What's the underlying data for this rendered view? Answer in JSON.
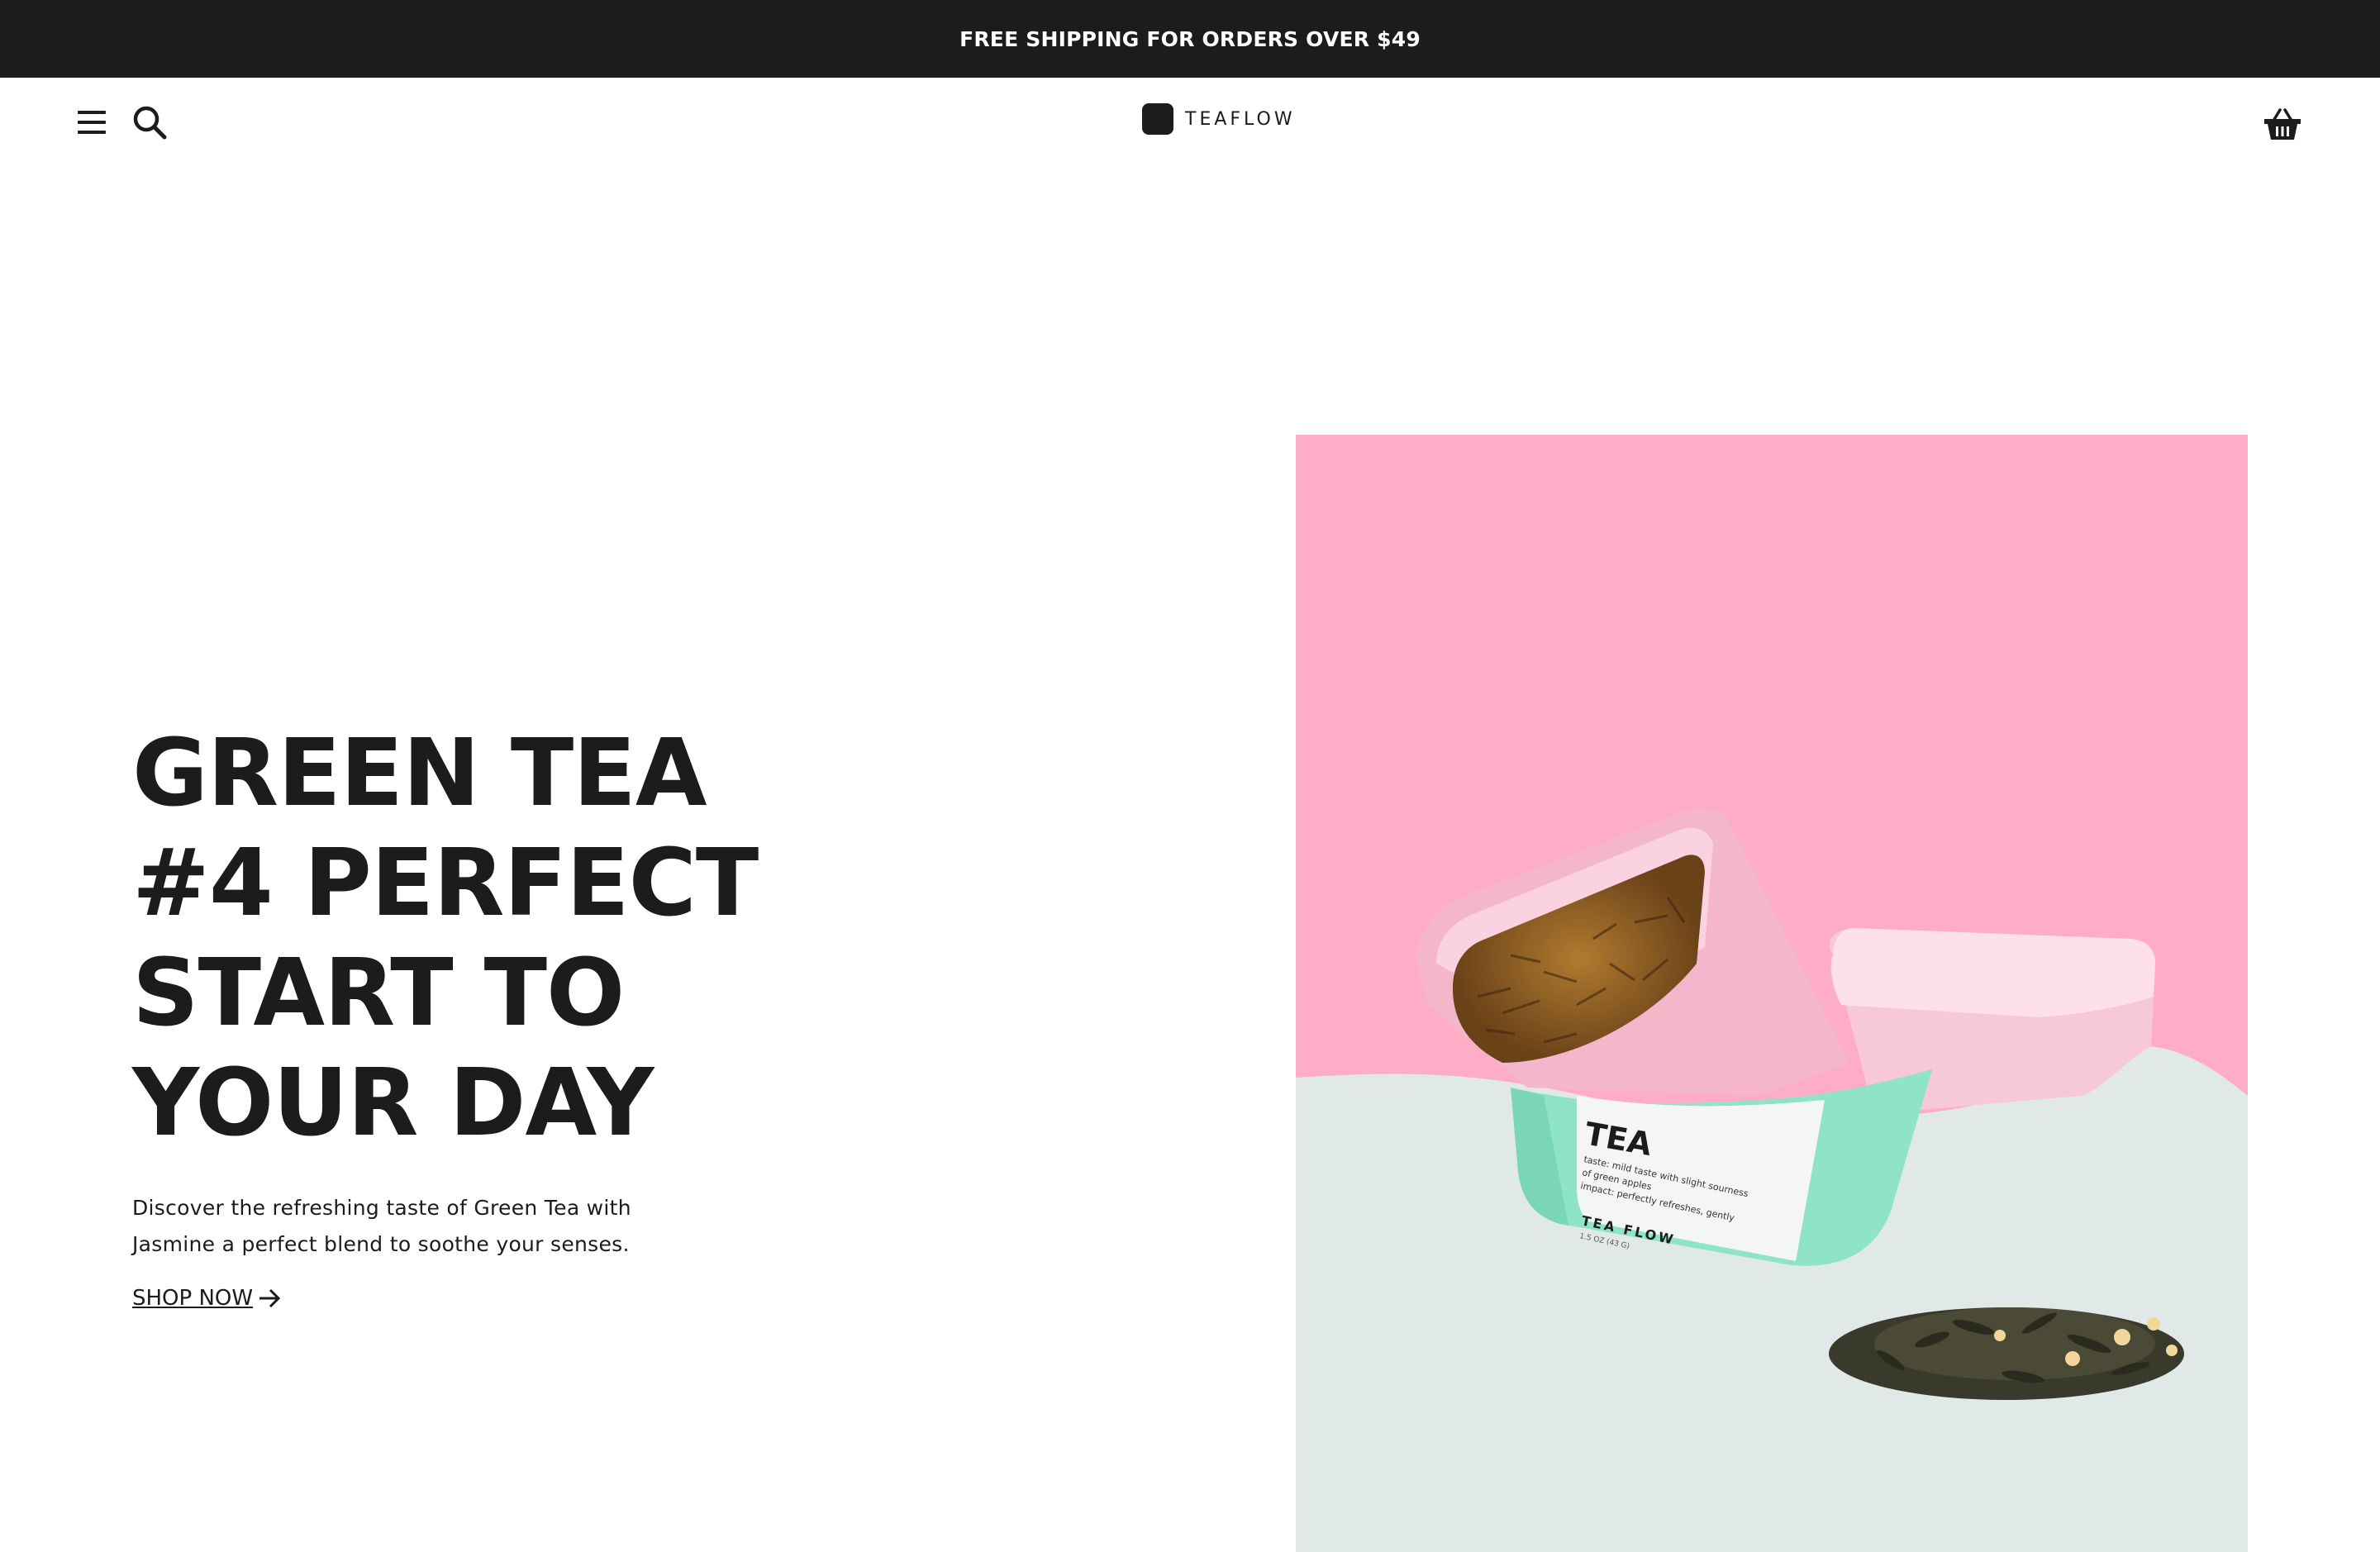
{
  "announcement": {
    "text": "FREE SHIPPING FOR ORDERS OVER $49"
  },
  "header": {
    "logo_text": "TEAFLOW",
    "icons": [
      "menu-icon",
      "search-icon",
      "cart-icon"
    ]
  },
  "hero": {
    "title_lines": [
      "GREEN TEA",
      "#4 PERFECT",
      "START TO",
      "YOUR DAY"
    ],
    "description_lines": [
      "Discover the refreshing taste of Green Tea with",
      "Jasmine a perfect blend to soothe your senses."
    ],
    "cta_label": "SHOP NOW ",
    "cta_icon": "arrow-right-icon",
    "image": {
      "tin_brand": "TEA",
      "tin_label_lines": [
        "taste: mild taste with slight sourness",
        "of green apples",
        "impact: perfectly refreshes, gently"
      ],
      "tin_name": "TEA FLOW",
      "tin_weight": "1.5 OZ (43 G)"
    }
  },
  "colors": {
    "announcement_bg": "#1c1c1c",
    "text_dark": "#1c1c1c",
    "image_pink": "#ffadc6",
    "image_mint": "#8fe3c6",
    "image_floor": "#e1e9e8"
  }
}
